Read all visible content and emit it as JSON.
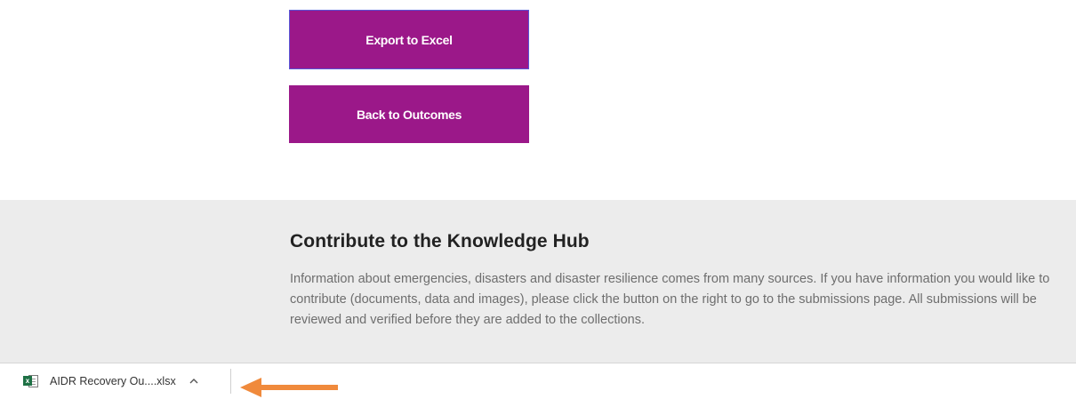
{
  "actions": {
    "export_label": "Export to Excel",
    "back_label": "Back to Outcomes"
  },
  "knowledge_hub": {
    "title": "Contribute to the Knowledge Hub",
    "body": "Information about emergencies, disasters and disaster resilience comes from many sources. If you have information you would like to contribute (documents, data and images), please click the button on the right to go to the submissions page. All submissions will be reviewed and verified before they are added to the collections."
  },
  "download_bar": {
    "file_name": "AIDR Recovery Ou....xlsx",
    "file_icon": "excel-file-icon",
    "expand_icon": "chevron-up-icon"
  },
  "colors": {
    "button_bg": "#9b1889",
    "button_focus_border": "#5a55d6",
    "hub_bg": "#ececec",
    "arrow": "#f08a3c"
  }
}
